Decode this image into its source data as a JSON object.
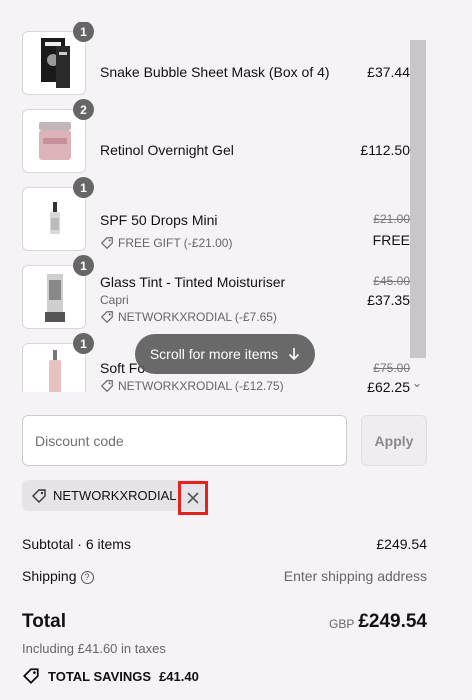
{
  "cart": {
    "items": [
      {
        "qty": "1",
        "name": "Snake Bubble Sheet Mask (Box of 4)",
        "price": "£37.44"
      },
      {
        "qty": "2",
        "name": "Retinol Overnight Gel",
        "price": "£112.50"
      },
      {
        "qty": "1",
        "name": "SPF 50 Drops Mini",
        "original_price": "£21.00",
        "price": "FREE",
        "discount": "FREE GIFT (-£21.00)"
      },
      {
        "qty": "1",
        "name": "Glass Tint - Tinted Moisturiser",
        "variant": "Capri",
        "original_price": "£45.00",
        "price": "£37.35",
        "discount": "NETWORKXRODIAL (-£7.65)"
      },
      {
        "qty": "1",
        "name": "Soft Fo",
        "original_price": "£75.00",
        "price": "£62.25",
        "discount": "NETWORKXRODIAL (-£12.75)"
      }
    ],
    "scroll_hint": "Scroll for more items"
  },
  "discount": {
    "placeholder": "Discount code",
    "apply_label": "Apply",
    "applied_code": "NETWORKXRODIAL"
  },
  "summary": {
    "subtotal_label": "Subtotal · 6 items",
    "subtotal_value": "£249.54",
    "shipping_label": "Shipping",
    "shipping_value": "Enter shipping address",
    "total_label": "Total",
    "currency": "GBP",
    "total_value": "£249.54",
    "taxes": "Including £41.60 in taxes",
    "savings_label": "TOTAL SAVINGS",
    "savings_value": "£41.40"
  },
  "colors": {
    "background": "#f5f3f6",
    "highlight": "#e3231f",
    "badge": "#666666"
  }
}
